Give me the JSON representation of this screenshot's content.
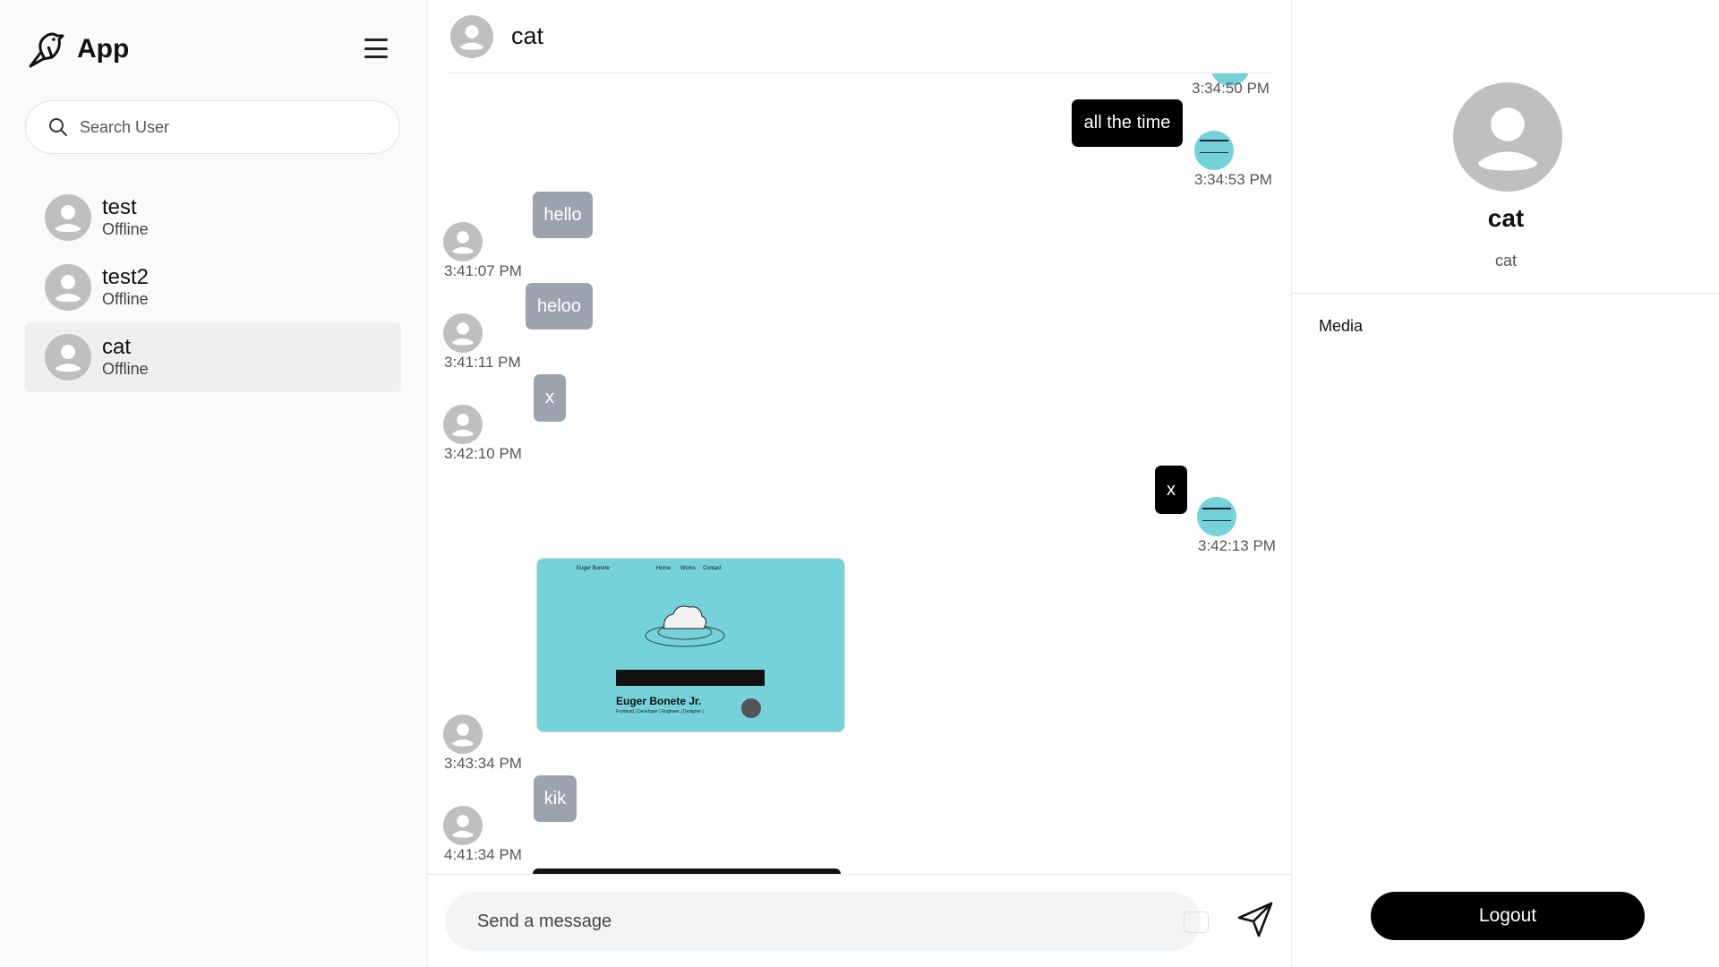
{
  "app": {
    "name": "App",
    "logo_icon": "bird-logo-icon",
    "menu_icon": "hamburger-menu-icon"
  },
  "search": {
    "placeholder": "Search User",
    "value": "",
    "icon": "search-icon"
  },
  "contacts": [
    {
      "name": "test",
      "status": "Offline",
      "active": false
    },
    {
      "name": "test2",
      "status": "Offline",
      "active": false
    },
    {
      "name": "cat",
      "status": "Offline",
      "active": true
    }
  ],
  "chat": {
    "header": {
      "name": "cat"
    },
    "messages": [
      {
        "direction": "out",
        "text": "",
        "time": "3:34:50 PM"
      },
      {
        "direction": "out",
        "text": "all the time",
        "time": "3:34:53 PM"
      },
      {
        "direction": "in",
        "text": "hello",
        "time": "3:41:07 PM"
      },
      {
        "direction": "in",
        "text": "heloo",
        "time": "3:41:11 PM"
      },
      {
        "direction": "in",
        "text": "x",
        "time": "3:42:10 PM"
      },
      {
        "direction": "out",
        "text": "x",
        "time": "3:42:13 PM"
      },
      {
        "direction": "in",
        "type": "image",
        "time": "3:43:34 PM",
        "image": {
          "brand": "Euger Bonete",
          "nav": [
            "Home",
            "Works",
            "Contact"
          ],
          "title": "Euger Bonete Jr.",
          "tagline": "Hello, I'm A React Web Developer.",
          "subtitle": "Frontend | Developer | Engineer | Designer |"
        }
      },
      {
        "direction": "in",
        "text": "kik",
        "time": "4:41:34 PM"
      }
    ]
  },
  "composer": {
    "placeholder": "Send a message",
    "value": "",
    "send_icon": "send-plane-icon"
  },
  "profile": {
    "name": "cat",
    "username": "cat",
    "media_label": "Media",
    "logout_label": "Logout"
  },
  "colors": {
    "incoming_bubble": "#9ca3af",
    "outgoing_bubble": "#000000",
    "accent_teal": "#74d2d8"
  }
}
